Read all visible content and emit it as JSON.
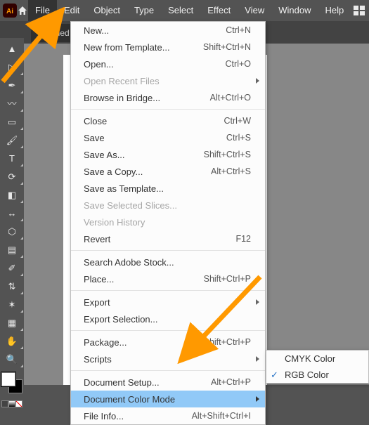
{
  "menubar": {
    "items": [
      "File",
      "Edit",
      "Object",
      "Type",
      "Select",
      "Effect",
      "View",
      "Window",
      "Help"
    ],
    "active_index": 0
  },
  "tab": {
    "label": "Untitled"
  },
  "menu": {
    "groups": [
      [
        {
          "label": "New...",
          "shortcut": "Ctrl+N",
          "enabled": true
        },
        {
          "label": "New from Template...",
          "shortcut": "Shift+Ctrl+N",
          "enabled": true
        },
        {
          "label": "Open...",
          "shortcut": "Ctrl+O",
          "enabled": true
        },
        {
          "label": "Open Recent Files",
          "shortcut": "",
          "enabled": false,
          "submenu": true
        },
        {
          "label": "Browse in Bridge...",
          "shortcut": "Alt+Ctrl+O",
          "enabled": true
        }
      ],
      [
        {
          "label": "Close",
          "shortcut": "Ctrl+W",
          "enabled": true
        },
        {
          "label": "Save",
          "shortcut": "Ctrl+S",
          "enabled": true
        },
        {
          "label": "Save As...",
          "shortcut": "Shift+Ctrl+S",
          "enabled": true
        },
        {
          "label": "Save a Copy...",
          "shortcut": "Alt+Ctrl+S",
          "enabled": true
        },
        {
          "label": "Save as Template...",
          "shortcut": "",
          "enabled": true
        },
        {
          "label": "Save Selected Slices...",
          "shortcut": "",
          "enabled": false
        },
        {
          "label": "Version History",
          "shortcut": "",
          "enabled": false
        },
        {
          "label": "Revert",
          "shortcut": "F12",
          "enabled": true
        }
      ],
      [
        {
          "label": "Search Adobe Stock...",
          "shortcut": "",
          "enabled": true
        },
        {
          "label": "Place...",
          "shortcut": "Shift+Ctrl+P",
          "enabled": true
        }
      ],
      [
        {
          "label": "Export",
          "shortcut": "",
          "enabled": true,
          "submenu": true
        },
        {
          "label": "Export Selection...",
          "shortcut": "",
          "enabled": true
        }
      ],
      [
        {
          "label": "Package...",
          "shortcut": "Alt+Shift+Ctrl+P",
          "enabled": true
        },
        {
          "label": "Scripts",
          "shortcut": "",
          "enabled": true,
          "submenu": true
        }
      ],
      [
        {
          "label": "Document Setup...",
          "shortcut": "Alt+Ctrl+P",
          "enabled": true
        },
        {
          "label": "Document Color Mode",
          "shortcut": "",
          "enabled": true,
          "submenu": true,
          "highlight": true
        },
        {
          "label": "File Info...",
          "shortcut": "Alt+Shift+Ctrl+I",
          "enabled": true
        }
      ]
    ]
  },
  "submenu": {
    "items": [
      {
        "label": "CMYK Color",
        "checked": false
      },
      {
        "label": "RGB Color",
        "checked": true
      }
    ]
  },
  "tools": [
    "selection-tool",
    "direct-selection-tool",
    "pen-tool",
    "curvature-tool",
    "rectangle-tool",
    "paintbrush-tool",
    "type-tool",
    "rotate-tool",
    "eraser-tool",
    "width-tool",
    "shape-builder-tool",
    "gradient-tool",
    "eyedropper-tool",
    "blend-tool",
    "symbol-sprayer-tool",
    "artboard-tool",
    "hand-tool",
    "zoom-tool"
  ],
  "tools_glyph": [
    "▲",
    "▷",
    "✒",
    "〰",
    "▭",
    "🖌",
    "T",
    "⟳",
    "◧",
    "↔",
    "⬡",
    "▤",
    "✐",
    "⇅",
    "✶",
    "▦",
    "✋",
    "🔍"
  ],
  "colors": {
    "accent": "#91c9f7",
    "arrow": "#ff9900"
  }
}
